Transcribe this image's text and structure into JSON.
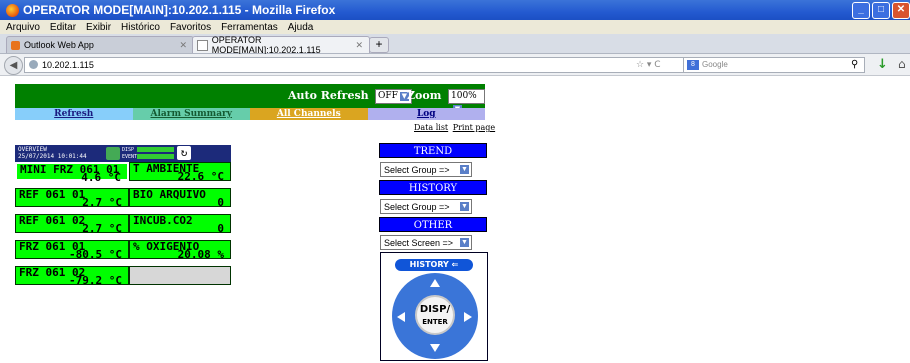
{
  "window": {
    "title": "OPERATOR MODE[MAIN]:10.202.1.115 - Mozilla Firefox",
    "controls": [
      "_",
      "□",
      "✕"
    ]
  },
  "menu": [
    "Arquivo",
    "Editar",
    "Exibir",
    "Histórico",
    "Favoritos",
    "Ferramentas",
    "Ajuda"
  ],
  "tabs": [
    {
      "label": "Outlook Web App"
    },
    {
      "label": "OPERATOR MODE[MAIN]:10.202.1.115"
    }
  ],
  "nav": {
    "url": "10.202.1.115",
    "search_placeholder": "Google",
    "search_engine": "8"
  },
  "page": {
    "auto_refresh_label": "Auto Refresh",
    "auto_refresh_value": "OFF",
    "zoom_label": "Zoom",
    "zoom_value": "100%",
    "nav_items": [
      "Refresh",
      "Alarm Summary",
      "All Channels",
      "Log"
    ],
    "links": [
      "Data list",
      "Print page"
    ],
    "overview": {
      "title": "OVERVIEW",
      "datetime": "25/07/2014 10:01:44",
      "disp_label": "DISP",
      "event_label": "EVENT",
      "channels": [
        {
          "name": "MINI FRZ 061 01",
          "value": "4.6 °C"
        },
        {
          "name": "T AMBIENTE",
          "value": "22.6 °C"
        },
        {
          "name": "REF 061 01",
          "value": "2.7 °C"
        },
        {
          "name": "BIO ARQUIVO",
          "value": "0"
        },
        {
          "name": "REF 061 02",
          "value": "2.7 °C"
        },
        {
          "name": "INCUB.CO2",
          "value": "0"
        },
        {
          "name": "FRZ 061 01",
          "value": "-80.5 °C"
        },
        {
          "name": "% OXIGENIO",
          "value": "20.08 %"
        },
        {
          "name": "FRZ 061 02",
          "value": "-79.2 °C"
        }
      ]
    },
    "side": {
      "trend_label": "TREND",
      "trend_select": "Select Group =>",
      "history_label": "HISTORY",
      "history_select": "Select Group =>",
      "other_label": "OTHER",
      "other_select": "Select Screen =>",
      "history_button": "HISTORY",
      "disp_top": "DISP/",
      "disp_bottom": "ENTER"
    }
  },
  "colors": {
    "header_green": "#008000",
    "cell_green": "#00ff00",
    "side_blue": "#0000ff"
  }
}
